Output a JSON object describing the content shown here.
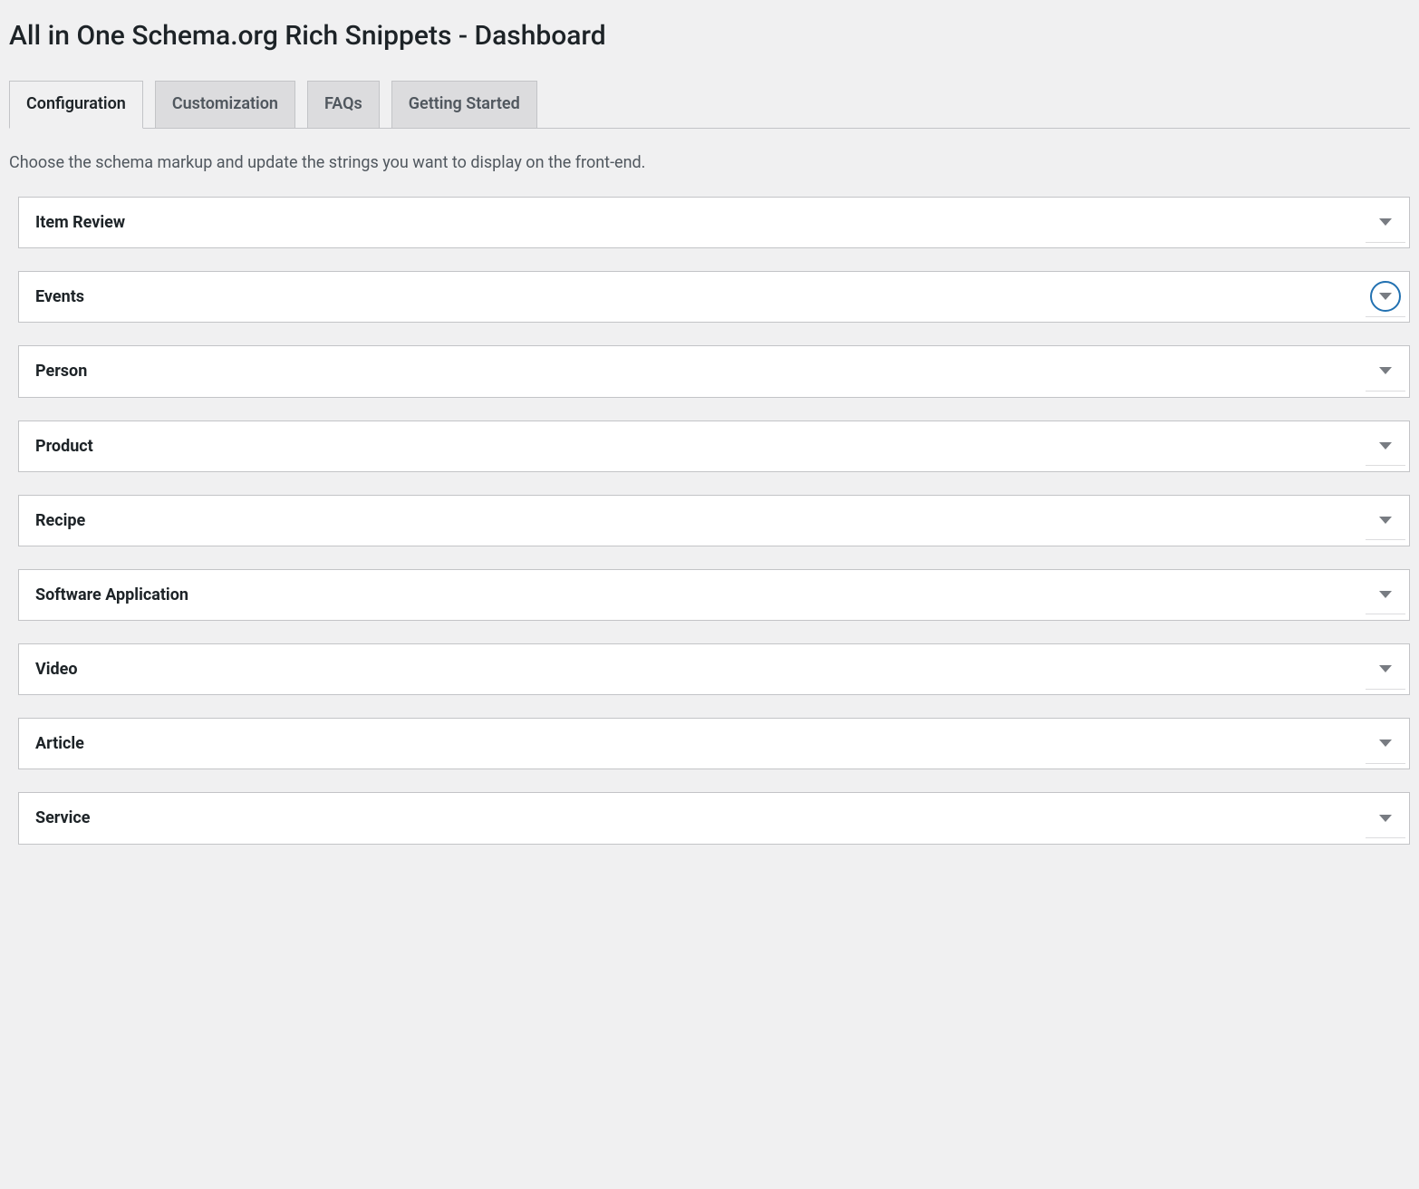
{
  "page_title": "All in One Schema.org Rich Snippets - Dashboard",
  "tabs": [
    {
      "label": "Configuration",
      "active": true
    },
    {
      "label": "Customization",
      "active": false
    },
    {
      "label": "FAQs",
      "active": false
    },
    {
      "label": "Getting Started",
      "active": false
    }
  ],
  "description": "Choose the schema markup and update the strings you want to display on the front-end.",
  "panels": [
    {
      "title": "Item Review",
      "focused": false
    },
    {
      "title": "Events",
      "focused": true
    },
    {
      "title": "Person",
      "focused": false
    },
    {
      "title": "Product",
      "focused": false
    },
    {
      "title": "Recipe",
      "focused": false
    },
    {
      "title": "Software Application",
      "focused": false
    },
    {
      "title": "Video",
      "focused": false
    },
    {
      "title": "Article",
      "focused": false
    },
    {
      "title": "Service",
      "focused": false
    }
  ]
}
